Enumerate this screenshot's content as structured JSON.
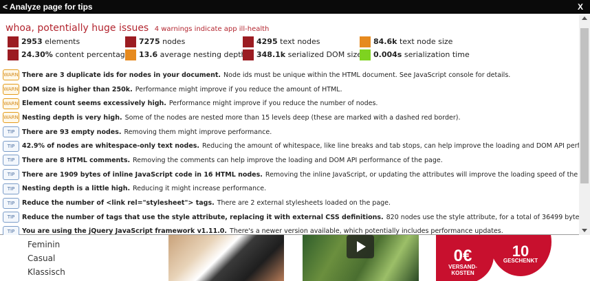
{
  "panel": {
    "title": "< Analyze page for tips",
    "close_label": "X"
  },
  "summary": {
    "headline": "whoa, potentially huge issues",
    "subline": "4 warnings indicate app ill-health"
  },
  "stats": [
    {
      "value": "2953",
      "label": "elements",
      "color": "#9b1c22"
    },
    {
      "value": "7275",
      "label": "nodes",
      "color": "#9b1c22"
    },
    {
      "value": "4295",
      "label": "text nodes",
      "color": "#9b1c22"
    },
    {
      "value": "84.6k",
      "label": "text node size",
      "color": "#e68a1f"
    },
    {
      "value": "24.30%",
      "label": "content percentage",
      "color": "#9b1c22"
    },
    {
      "value": "13.6",
      "label": "average nesting depth",
      "color": "#e68a1f"
    },
    {
      "value": "348.1k",
      "label": "serialized DOM size",
      "color": "#9b1c22"
    },
    {
      "value": "0.004s",
      "label": "serialization time",
      "color": "#7ed320"
    }
  ],
  "tips": [
    {
      "type": "WARN",
      "bold": "There are 3 duplicate ids for nodes in your document.",
      "text": "Node ids must be unique within the HTML document. See JavaScript console for details."
    },
    {
      "type": "WARN",
      "bold": "DOM size is higher than 250k.",
      "text": "Performance might improve if you reduce the amount of HTML."
    },
    {
      "type": "WARN",
      "bold": "Element count seems excessively high.",
      "text": "Performance might improve if you reduce the number of nodes."
    },
    {
      "type": "WARN",
      "bold": "Nesting depth is very high.",
      "text": "Some of the nodes are nested more than 15 levels deep (these are marked with a dashed red border)."
    },
    {
      "type": "TIP",
      "bold": "There are 93 empty nodes.",
      "text": "Removing them might improve performance."
    },
    {
      "type": "TIP",
      "bold": "42.9% of nodes are whitespace-only text nodes.",
      "text": "Reducing the amount of whitespace, like line breaks and tab stops, can help improve the loading and DOM API performance of the page."
    },
    {
      "type": "TIP",
      "bold": "There are 8 HTML comments.",
      "text": "Removing the comments can help improve the loading and DOM API performance of the page."
    },
    {
      "type": "TIP",
      "bold": "There are 1909 bytes of inline JavaScript code in 16 HTML nodes.",
      "text": "Removing the inline JavaScript, or updating the attributes will improve the loading speed of the page."
    },
    {
      "type": "TIP",
      "bold": "Nesting depth is a little high.",
      "text": "Reducing it might increase performance."
    },
    {
      "type": "TIP",
      "bold": "Reduce the number of <link rel=\"stylesheet\"> tags.",
      "text": "There are 2 external stylesheets loaded on the page."
    },
    {
      "type": "TIP",
      "bold": "Reduce the number of tags that use the style attribute, replacing it with external CSS definitions.",
      "text": "820 nodes use the style attribute, for a total of 36499 bytes."
    },
    {
      "type": "TIP",
      "bold": "You are using the jQuery JavaScript framework v1.11.0.",
      "text": "There's a newer version available, which potentially includes performance updates."
    }
  ],
  "background": {
    "menu": [
      "Feminin",
      "Casual",
      "Klassisch"
    ],
    "promo_left": {
      "big": "0€",
      "small": "VERSAND-KOSTEN"
    },
    "promo_right": {
      "big": "10",
      "small": "GESCHENKT"
    }
  }
}
